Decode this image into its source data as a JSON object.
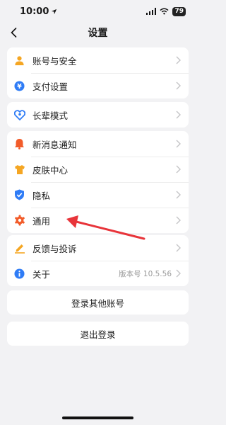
{
  "status_bar": {
    "time": "10:00",
    "battery": "79"
  },
  "nav": {
    "title": "设置"
  },
  "groups": {
    "account": [
      {
        "label": "账号与安全",
        "icon": "user-icon",
        "color": "#f5a623"
      },
      {
        "label": "支付设置",
        "icon": "yuan-icon",
        "color": "#2f7cf6"
      }
    ],
    "elder": [
      {
        "label": "长辈模式",
        "icon": "heart-icon",
        "color": "#2f7cf6"
      }
    ],
    "prefs": [
      {
        "label": "新消息通知",
        "icon": "bell-icon",
        "color": "#f25c2a"
      },
      {
        "label": "皮肤中心",
        "icon": "shirt-icon",
        "color": "#f5a623"
      },
      {
        "label": "隐私",
        "icon": "shield-icon",
        "color": "#2f7cf6"
      },
      {
        "label": "通用",
        "icon": "gear-icon",
        "color": "#f25c2a"
      }
    ],
    "about": [
      {
        "label": "反馈与投诉",
        "icon": "pen-icon",
        "color": "#f5a623"
      },
      {
        "label": "关于",
        "icon": "info-icon",
        "color": "#2f7cf6",
        "value": "版本号 10.5.56"
      }
    ]
  },
  "buttons": {
    "switch_account": "登录其他账号",
    "logout": "退出登录"
  },
  "colors": {
    "arrow": "#e8343a",
    "background": "#f2f2f4"
  }
}
